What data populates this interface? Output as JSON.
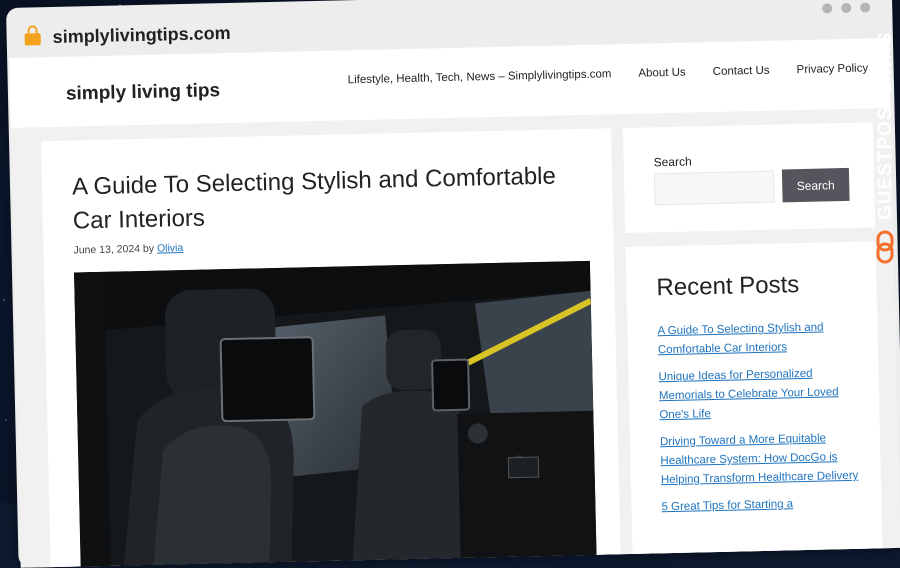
{
  "browser": {
    "url": "simplylivingtips.com"
  },
  "header": {
    "site_title": "simply living tips",
    "nav": [
      "Lifestyle, Health, Tech, News – Simplylivingtips.com",
      "About Us",
      "Contact Us",
      "Privacy Policy"
    ]
  },
  "article": {
    "title": "A Guide To Selecting Stylish and Comfortable Car Interiors",
    "date": "June 13, 2024",
    "by": "by",
    "author": "Olivia"
  },
  "sidebar": {
    "search_label": "Search",
    "search_button": "Search",
    "search_value": "",
    "recent_title": "Recent Posts",
    "recent_posts": [
      "A Guide To Selecting Stylish and Comfortable Car Interiors",
      "Unique Ideas for Personalized Memorials to Celebrate Your Loved One's Life",
      "Driving Toward a More Equitable Healthcare System: How DocGo is Helping Transform Healthcare Delivery",
      "5 Great Tips for Starting a"
    ]
  },
  "badge": {
    "text": "GUESTPOSTLINKS"
  },
  "colors": {
    "link": "#1e73be",
    "badge_accent": "#f36f2a",
    "search_button": "#55555e"
  }
}
